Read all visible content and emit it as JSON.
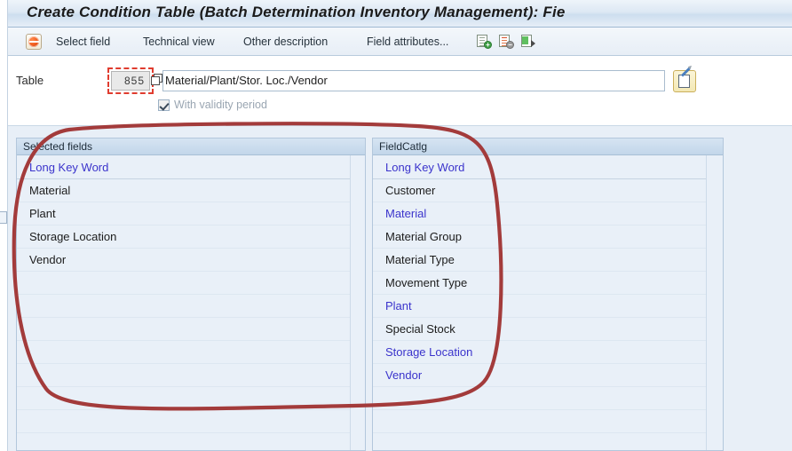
{
  "window": {
    "title": "Create Condition Table (Batch Determination Inventory Management): Fie"
  },
  "toolbar": {
    "select_field_label": "Select field",
    "technical_view_label": "Technical view",
    "other_description_label": "Other description",
    "field_attributes_label": "Field attributes...",
    "icons": [
      "select-field-icon",
      "add-field-icon",
      "remove-field-icon",
      "propose-field-icon"
    ]
  },
  "form": {
    "table_label": "Table",
    "table_number": "855",
    "table_number_selected": true,
    "description_value": "Material/Plant/Stor. Loc./Vendor",
    "description_placeholder": "",
    "edit_button_icon": "edit-pencil-icon",
    "multiselect_icon": "multi-selection-icon",
    "validity_label": "With validity period",
    "validity_checked": true,
    "validity_disabled": true
  },
  "panels": {
    "selected_fields": {
      "header": "Selected fields",
      "column_header": "Long Key Word",
      "rows": [
        {
          "label": "Material",
          "highlighted": false
        },
        {
          "label": "Plant",
          "highlighted": false
        },
        {
          "label": "Storage Location",
          "highlighted": false
        },
        {
          "label": "Vendor",
          "highlighted": false
        }
      ]
    },
    "field_catalog": {
      "header": "FieldCatlg",
      "column_header": "Long Key Word",
      "rows": [
        {
          "label": "Customer",
          "highlighted": false
        },
        {
          "label": "Material",
          "highlighted": true
        },
        {
          "label": "Material Group",
          "highlighted": false
        },
        {
          "label": "Material Type",
          "highlighted": false
        },
        {
          "label": "Movement Type",
          "highlighted": false
        },
        {
          "label": "Plant",
          "highlighted": true
        },
        {
          "label": "Special Stock",
          "highlighted": false
        },
        {
          "label": "Storage Location",
          "highlighted": true
        },
        {
          "label": "Vendor",
          "highlighted": true
        }
      ]
    }
  },
  "colors": {
    "link_blue": "#3b34cc",
    "annotation_red": "#a33b3b",
    "selection_red": "#e03c2f",
    "panel_bg": "#e9f0f8",
    "titlebar_blue": "#cddeef"
  }
}
